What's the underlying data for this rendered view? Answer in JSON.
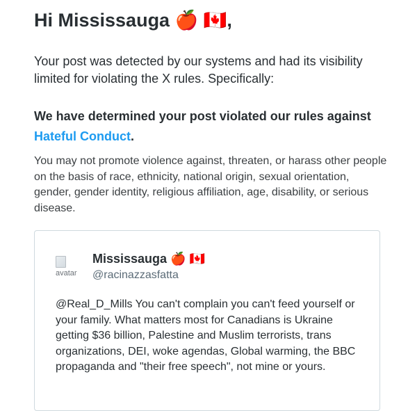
{
  "greeting": {
    "text": "Hi Mississauga 🍎 🇨🇦,"
  },
  "intro": {
    "text": "Your post was detected by our systems and had its visibility limited for violating the X rules. Specifically:"
  },
  "verdict": {
    "prefix": "We have determined your post violated our rules against ",
    "link_text": "Hateful Conduct",
    "suffix": ".",
    "link_color": "#1d9bf0"
  },
  "rule_description": {
    "text": "You may not promote violence against, threaten, or harass other people on the basis of race, ethnicity, national origin, sexual orientation, gender, gender identity, religious affiliation, age, disability, or serious disease."
  },
  "post": {
    "avatar_alt": "avatar",
    "author_name": "Mississauga 🍎 🇨🇦",
    "author_handle": "@racinazzasfatta",
    "text": "@Real_D_Mills You can't complain you can't feed yourself or your family. What matters most for Canadians is Ukraine getting $36 billion, Palestine and Muslim terrorists, trans organizations, DEI, woke agendas, Global warming, the BBC propaganda and \"their free speech\", not mine or yours."
  }
}
